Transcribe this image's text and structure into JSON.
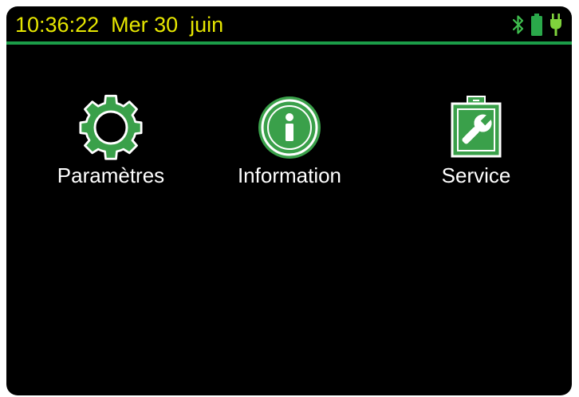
{
  "status_bar": {
    "time": "10:36:22",
    "date": "Mer 30  juin",
    "icons": [
      "bluetooth-icon",
      "battery-icon",
      "plug-icon"
    ]
  },
  "colors": {
    "accent": "#1b9d48",
    "icon_green": "#3aa04a",
    "status_text": "#e6e600",
    "background": "#000000"
  },
  "menu": {
    "items": [
      {
        "label": "Paramètres",
        "icon": "gear-icon"
      },
      {
        "label": "Information",
        "icon": "info-icon"
      },
      {
        "label": "Service",
        "icon": "toolbox-wrench-icon"
      }
    ]
  }
}
